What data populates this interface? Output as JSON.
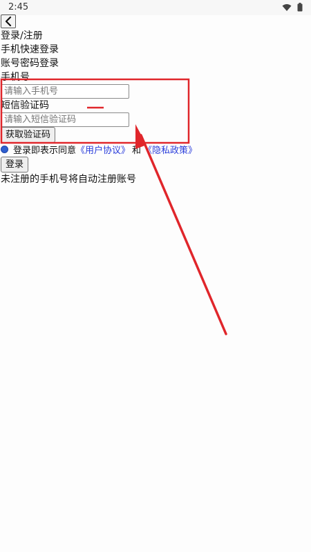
{
  "status_bar": {
    "time": "2:45",
    "icons": [
      "wifi-icon",
      "battery-icon"
    ]
  },
  "nav": {
    "back_icon": "chevron-left-icon"
  },
  "page": {
    "title": "登录/注册",
    "tab_phone_quick": "手机快速登录",
    "tab_account_password": "账号密码登录"
  },
  "form": {
    "phone_label": "手机号",
    "phone_placeholder": "请输入手机号",
    "sms_label": "短信验证码",
    "sms_placeholder": "请输入短信验证码",
    "get_code_button": "获取验证码",
    "agree_prefix": "登录即表示同意",
    "user_agreement": "《用户协议》",
    "and_text": "和",
    "privacy_policy": "《隐私政策》",
    "login_button": "登录",
    "auto_register_note": "未注册的手机号将自动注册账号"
  },
  "colors": {
    "annotation": "#e0262b",
    "link": "#2a3ddb"
  }
}
